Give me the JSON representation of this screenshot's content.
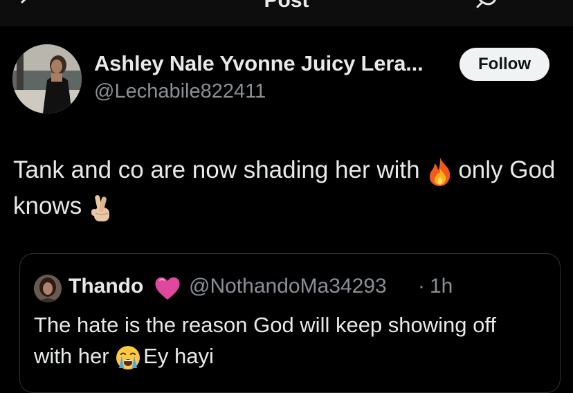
{
  "header": {
    "title": "Post"
  },
  "author": {
    "name": "Ashley Nale Yvonne Juicy Lera...",
    "handle": "@Lechabile822411",
    "follow_label": "Follow"
  },
  "post": {
    "text_part1": "Tank and co are now shading her with ",
    "text_part2": "only God knows ",
    "emojis": [
      "fire-emoji",
      "crossed-fingers-emoji"
    ]
  },
  "quote": {
    "name": "Thando",
    "handle": "@NothandoMa34293",
    "separator": "·",
    "time": "1h",
    "text_part1": "The hate is the reason God will keep showing off with her ",
    "text_part2": "Ey hayi",
    "emojis": [
      "pink-heart-emoji",
      "loudly-crying-face-emoji"
    ]
  },
  "colors": {
    "background": "#000000",
    "primary_text": "#e7e9ea",
    "secondary_text": "#8b9096",
    "border": "#2f3336",
    "follow_bg": "#eff3f4",
    "heart": "#e0479e"
  }
}
